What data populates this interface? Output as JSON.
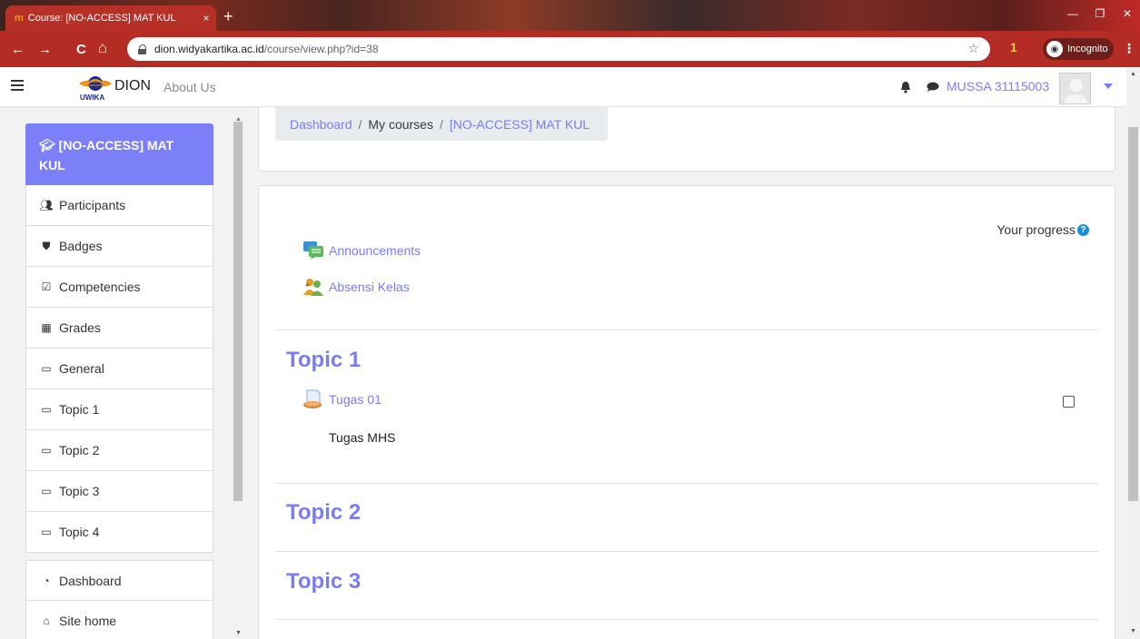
{
  "browser": {
    "tab_title": "Course: [NO-ACCESS] MAT KUL",
    "tab_favicon": "m",
    "tab_close": "×",
    "new_tab": "+",
    "url_host": "dion.widyakartika.ac.id",
    "url_path": "/course/view.php?id=38",
    "incognito_label": "Incognito",
    "window_min": "—",
    "window_max": "❐",
    "window_close": "✕",
    "menu": "⋮",
    "star": "☆",
    "extension": "1",
    "nav_back": "←",
    "nav_forward": "→",
    "nav_reload": "C",
    "nav_home": "⌂"
  },
  "navbar": {
    "brand": "DION",
    "logo_text": "UWIKA",
    "about": "About Us",
    "user_name": "MUSSA 31115003",
    "accent": "#7a7cf5"
  },
  "drawer": {
    "course_title": "[NO-ACCESS] MAT KUL",
    "course_icon": "graduation-cap-icon",
    "items": [
      {
        "label": "Participants",
        "icon": "users-icon"
      },
      {
        "label": "Badges",
        "icon": "shield-icon"
      },
      {
        "label": "Competencies",
        "icon": "checkbox-icon"
      },
      {
        "label": "Grades",
        "icon": "table-icon"
      },
      {
        "label": "General",
        "icon": "folder-icon"
      },
      {
        "label": "Topic 1",
        "icon": "folder-icon"
      },
      {
        "label": "Topic 2",
        "icon": "folder-icon"
      },
      {
        "label": "Topic 3",
        "icon": "folder-icon"
      },
      {
        "label": "Topic 4",
        "icon": "folder-icon"
      }
    ],
    "items2": [
      {
        "label": "Dashboard",
        "icon": "tachometer-icon"
      },
      {
        "label": "Site home",
        "icon": "home-icon"
      }
    ]
  },
  "breadcrumb": {
    "dashboard": "Dashboard",
    "my_courses": "My courses",
    "course": "[NO-ACCESS] MAT KUL",
    "separator": "/"
  },
  "main": {
    "progress_label": "Your progress",
    "progress_help": "?",
    "announcements": "Announcements",
    "attendance": "Absensi Kelas",
    "topic1": "Topic 1",
    "assignment": "Tugas 01",
    "assignment_desc": "Tugas MHS",
    "topic2": "Topic 2",
    "topic3": "Topic 3"
  }
}
